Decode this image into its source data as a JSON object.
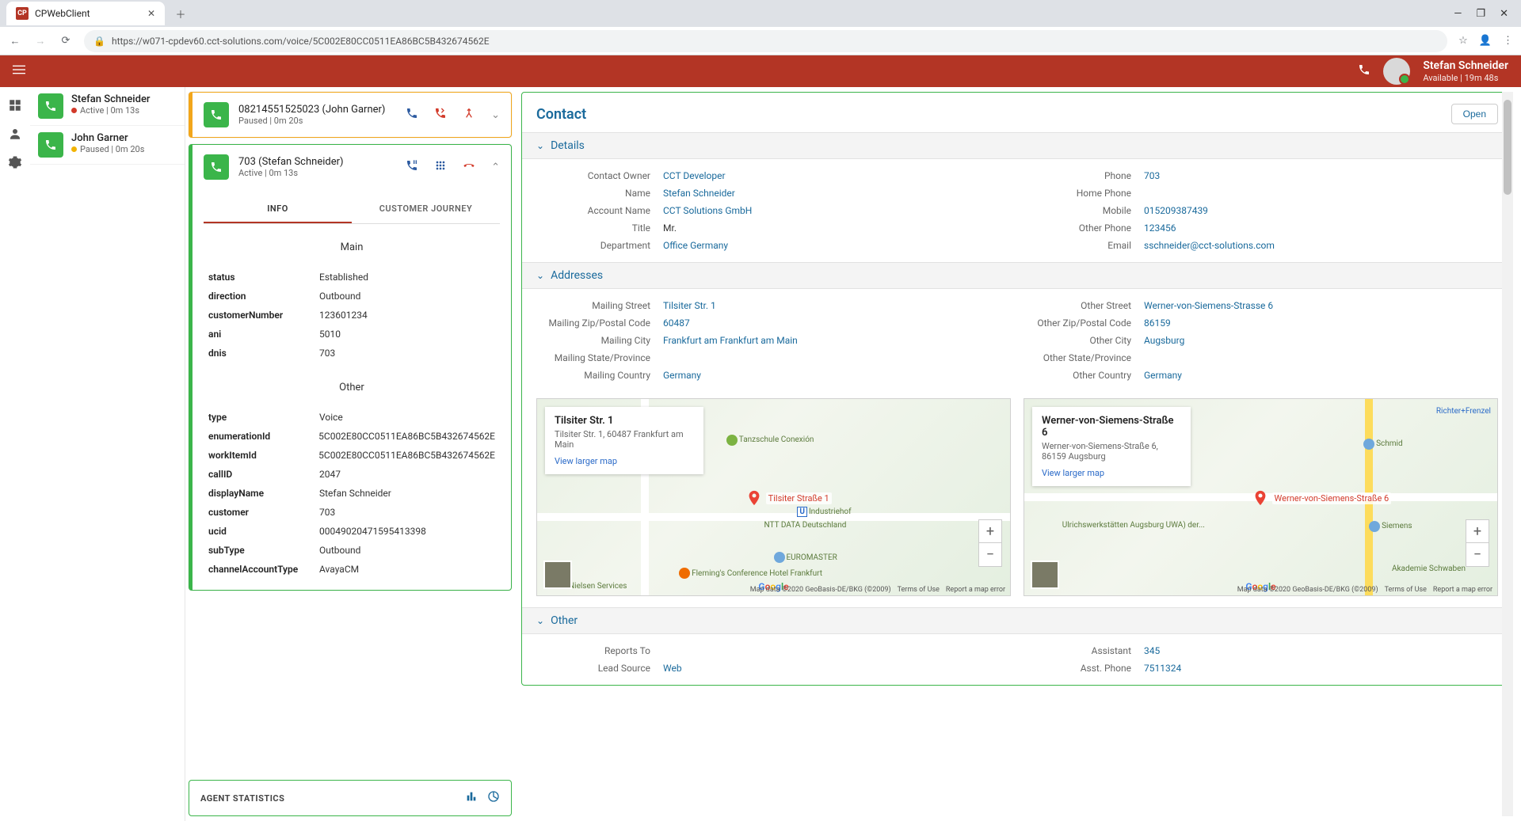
{
  "browser": {
    "tab_title": "CPWebClient",
    "favicon_text": "CP",
    "url": "https://w071-cpdev60.cct-solutions.com/voice/5C002E80CC0511EA86BC5B432674562E"
  },
  "user": {
    "name": "Stefan Schneider",
    "status": "Available | 19m 48s"
  },
  "conversations": [
    {
      "name": "Stefan Schneider",
      "status_dot": "red",
      "status": "Active | 0m 13s"
    },
    {
      "name": "John Garner",
      "status_dot": "yellow",
      "status": "Paused | 0m 20s"
    }
  ],
  "paused_call": {
    "title": "08214551525023 (John Garner)",
    "sub": "Paused | 0m 20s"
  },
  "active_call": {
    "title": "703 (Stefan Schneider)",
    "sub": "Active | 0m 13s",
    "tabs": {
      "info": "INFO",
      "journey": "CUSTOMER JOURNEY"
    },
    "main_header": "Main",
    "other_header": "Other",
    "main_kv": [
      {
        "k": "status",
        "v": "Established"
      },
      {
        "k": "direction",
        "v": "Outbound"
      },
      {
        "k": "customerNumber",
        "v": "123601234"
      },
      {
        "k": "ani",
        "v": "5010"
      },
      {
        "k": "dnis",
        "v": "703"
      }
    ],
    "other_kv": [
      {
        "k": "type",
        "v": "Voice"
      },
      {
        "k": "enumerationId",
        "v": "5C002E80CC0511EA86BC5B432674562E"
      },
      {
        "k": "workItemId",
        "v": "5C002E80CC0511EA86BC5B432674562E"
      },
      {
        "k": "callID",
        "v": "2047"
      },
      {
        "k": "displayName",
        "v": "Stefan Schneider"
      },
      {
        "k": "customer",
        "v": "703"
      },
      {
        "k": "ucid",
        "v": "00049020471595413398"
      },
      {
        "k": "subType",
        "v": "Outbound"
      },
      {
        "k": "channelAccountType",
        "v": "AvayaCM"
      }
    ]
  },
  "agent_stats": {
    "title": "AGENT STATISTICS"
  },
  "contact": {
    "title": "Contact",
    "open": "Open",
    "sections": {
      "details": "Details",
      "addresses": "Addresses",
      "other": "Other"
    },
    "details_left": [
      {
        "l": "Contact Owner",
        "v": "CCT Developer",
        "link": true
      },
      {
        "l": "Name",
        "v": "Stefan Schneider",
        "link": true
      },
      {
        "l": "Account Name",
        "v": "CCT Solutions GmbH",
        "link": true
      },
      {
        "l": "Title",
        "v": "Mr.",
        "link": false
      },
      {
        "l": "Department",
        "v": "Office Germany",
        "link": true
      }
    ],
    "details_right": [
      {
        "l": "Phone",
        "v": "703",
        "link": true
      },
      {
        "l": "Home Phone",
        "v": "",
        "link": false
      },
      {
        "l": "Mobile",
        "v": "015209387439",
        "link": true
      },
      {
        "l": "Other Phone",
        "v": "123456",
        "link": true
      },
      {
        "l": "Email",
        "v": "sschneider@cct-solutions.com",
        "link": true
      }
    ],
    "addr_left": [
      {
        "l": "Mailing Street",
        "v": "Tilsiter Str. 1",
        "link": true
      },
      {
        "l": "Mailing Zip/Postal Code",
        "v": "60487",
        "link": true
      },
      {
        "l": "Mailing City",
        "v": "Frankfurt am Frankfurt am Main",
        "link": true
      },
      {
        "l": "Mailing State/Province",
        "v": "",
        "link": false
      },
      {
        "l": "Mailing Country",
        "v": "Germany",
        "link": true
      }
    ],
    "addr_right": [
      {
        "l": "Other Street",
        "v": "Werner-von-Siemens-Strasse 6",
        "link": true
      },
      {
        "l": "Other Zip/Postal Code",
        "v": "86159",
        "link": true
      },
      {
        "l": "Other City",
        "v": "Augsburg",
        "link": true
      },
      {
        "l": "Other State/Province",
        "v": "",
        "link": false
      },
      {
        "l": "Other Country",
        "v": "Germany",
        "link": true
      }
    ],
    "other_left": [
      {
        "l": "Reports To",
        "v": "",
        "link": false
      },
      {
        "l": "Lead Source",
        "v": "Web",
        "link": true
      }
    ],
    "other_right": [
      {
        "l": "Assistant",
        "v": "345",
        "link": true
      },
      {
        "l": "Asst. Phone",
        "v": "7511324",
        "link": true
      }
    ],
    "map1": {
      "title": "Tilsiter Str. 1",
      "sub": "Tilsiter Str. 1, 60487 Frankfurt am Main",
      "link": "View larger map",
      "pin_label": "Tilsiter Straße 1",
      "attribution": "Map data ©2020 GeoBasis-DE/BKG (©2009)",
      "terms": "Terms of Use",
      "report": "Report a map error"
    },
    "map2": {
      "title": "Werner-von-Siemens-Straße 6",
      "sub": "Werner-von-Siemens-Straße 6, 86159 Augsburg",
      "link": "View larger map",
      "pin_label": "Werner-von-Siemens-Straße 6",
      "attribution": "Map data ©2020 GeoBasis-DE/BKG (©2009)",
      "terms": "Terms of Use",
      "report": "Report a map error"
    }
  }
}
